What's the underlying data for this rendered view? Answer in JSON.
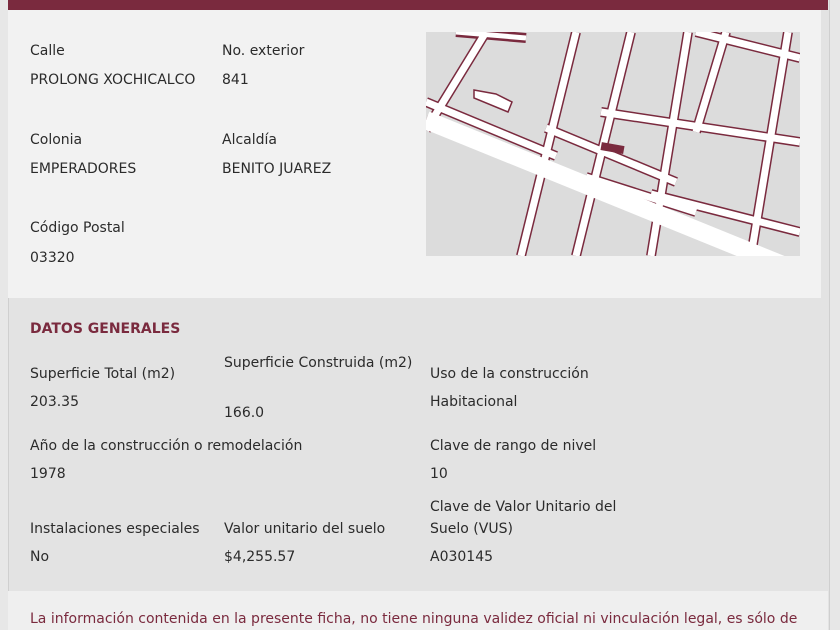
{
  "address": {
    "calle_label": "Calle",
    "calle_value": "PROLONG XOCHICALCO",
    "no_ext_label": "No. exterior",
    "no_ext_value": "841",
    "colonia_label": "Colonia",
    "colonia_value": "EMPERADORES",
    "alcaldia_label": "Alcaldía",
    "alcaldia_value": "BENITO JUAREZ",
    "cp_label": "Código Postal",
    "cp_value": "03320"
  },
  "map": {
    "road_color": "#ffffff",
    "block_color": "#dcdcdc",
    "outline_color": "#7a2a3e",
    "parcel_color": "#7a2a3e"
  },
  "general": {
    "title": "DATOS GENERALES",
    "sup_total_label": "Superficie Total (m2)",
    "sup_total_value": "203.35",
    "sup_constr_label": "Superficie Construida (m2)",
    "sup_constr_value": "166.0",
    "uso_label": "Uso de la construcción",
    "uso_value": "Habitacional",
    "anio_label": "Año de la construcción o remodelación",
    "anio_value": "1978",
    "rango_label": "Clave de rango de nivel",
    "rango_value": "10",
    "inst_label": "Instalaciones especiales",
    "inst_value": "No",
    "valor_label": "Valor unitario del suelo",
    "valor_value": "$4,255.57",
    "vus_label": "Clave de Valor Unitario del Suelo (VUS)",
    "vus_value": "A030145"
  },
  "disclaimer": "La información contenida en la presente ficha, no tiene ninguna validez oficial ni vinculación legal, es sólo de"
}
